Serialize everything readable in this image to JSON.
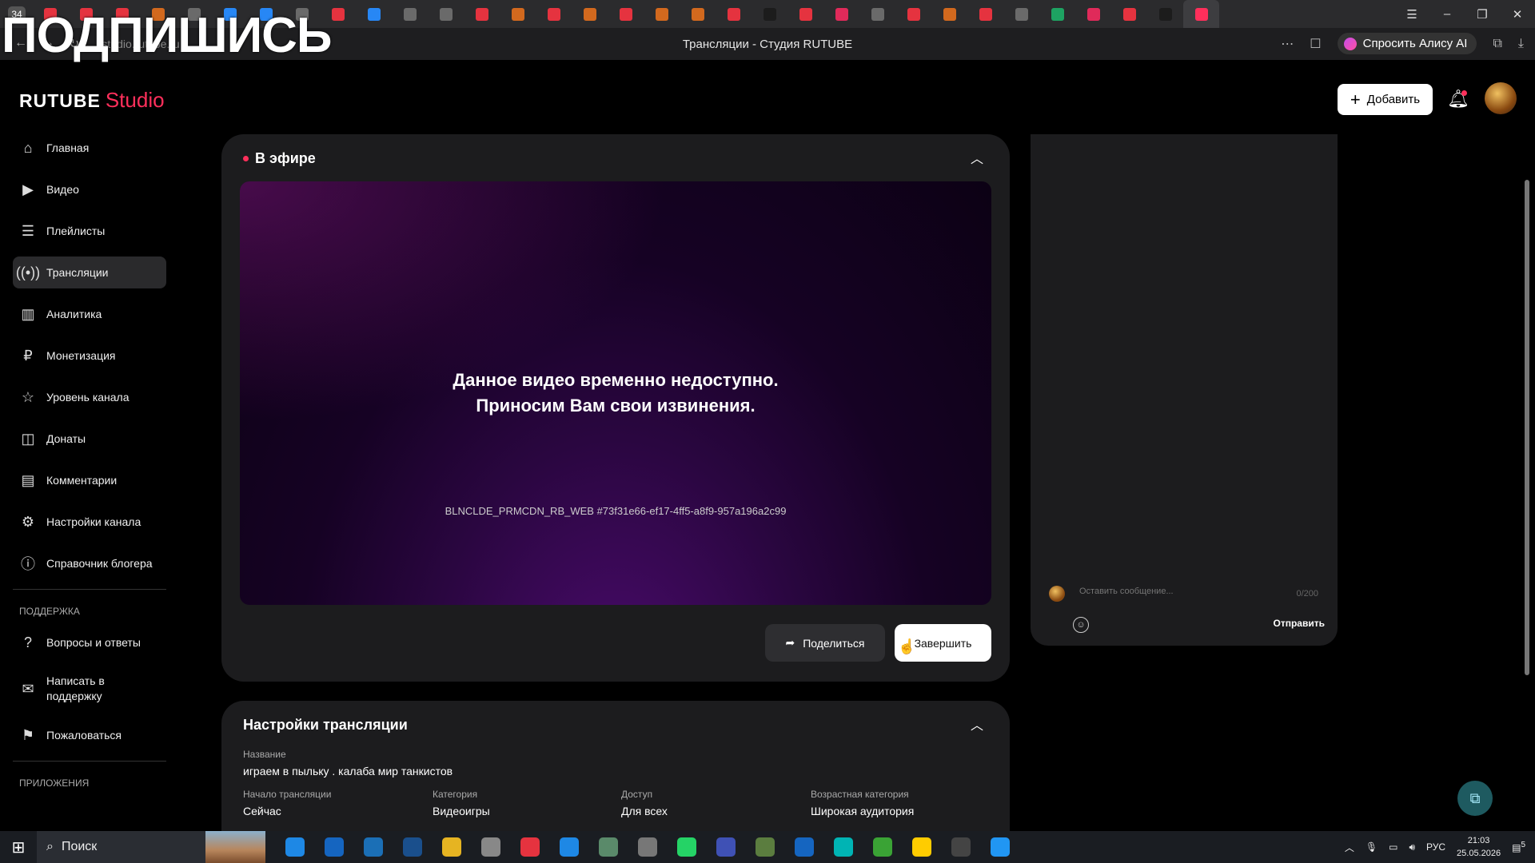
{
  "browser": {
    "tab_count": "34",
    "url": "studio.rutube.ru",
    "page_title": "Трансляции - Студия RUTUBE",
    "alice_label": "Спросить Алису AI",
    "tab_icon_colors": [
      "#e5333f",
      "#e5333f",
      "#e5333f",
      "#d2691e",
      "#6a6a6a",
      "#2787f5",
      "#2787f5",
      "#6a6a6a",
      "#e5333f",
      "#2787f5",
      "#6a6a6a",
      "#6a6a6a",
      "#e5333f",
      "#d2691e",
      "#e5333f",
      "#d2691e",
      "#e5333f",
      "#d2691e",
      "#d2691e",
      "#e5333f",
      "#1c1c1c",
      "#e5333f",
      "#e02a5a",
      "#6a6a6a",
      "#e5333f",
      "#d2691e",
      "#e5333f",
      "#6a6a6a",
      "#1ea362",
      "#e02a5a",
      "#e5333f",
      "#1c1c1c",
      "#ff2f5b"
    ]
  },
  "overlay_text": "ПОДПИШИСЬ",
  "header": {
    "logo_main": "RUTUBE",
    "logo_sub": "Studio",
    "add_label": "Добавить"
  },
  "sidebar": {
    "items": [
      {
        "label": "Главная",
        "icon": "home-icon"
      },
      {
        "label": "Видео",
        "icon": "video-icon"
      },
      {
        "label": "Плейлисты",
        "icon": "playlist-icon"
      },
      {
        "label": "Трансляции",
        "icon": "broadcast-icon"
      },
      {
        "label": "Аналитика",
        "icon": "analytics-icon"
      },
      {
        "label": "Монетизация",
        "icon": "ruble-icon"
      },
      {
        "label": "Уровень канала",
        "icon": "star-icon"
      },
      {
        "label": "Донаты",
        "icon": "donate-icon"
      },
      {
        "label": "Комментарии",
        "icon": "comment-icon"
      },
      {
        "label": "Настройки канала",
        "icon": "gear-icon"
      },
      {
        "label": "Справочник блогера",
        "icon": "info-icon"
      }
    ],
    "support_heading": "ПОДДЕРЖКА",
    "support_items": [
      {
        "label": "Вопросы и ответы",
        "icon": "question-icon"
      },
      {
        "label": "Написать в поддержку",
        "icon": "mail-icon"
      },
      {
        "label": "Пожаловаться",
        "icon": "flag-icon"
      }
    ],
    "apps_heading": "ПРИЛОЖЕНИЯ"
  },
  "live": {
    "title": "В эфире",
    "message_line1": "Данное видео временно недоступно.",
    "message_line2": "Приносим Вам свои извинения.",
    "error_code": "BLNCLDE_PRMCDN_RB_WEB #73f31e66-ef17-4ff5-a8f9-957a196a2c99",
    "share_label": "Поделиться",
    "finish_label": "Завершить"
  },
  "chat": {
    "placeholder": "Оставить сообщение...",
    "counter": "0/200",
    "send_label": "Отправить"
  },
  "settings": {
    "title": "Настройки трансляции",
    "name_label": "Название",
    "name_value": "играем в пыльку . калаба мир танкистов",
    "fields": [
      {
        "label": "Начало трансляции",
        "value": "Сейчас"
      },
      {
        "label": "Категория",
        "value": "Видеоигры"
      },
      {
        "label": "Доступ",
        "value": "Для всех"
      },
      {
        "label": "Возрастная категория",
        "value": "Широкая аудитория"
      }
    ]
  },
  "taskbar": {
    "search_label": "Поиск",
    "lang": "РУС",
    "time": "21:03",
    "date": "25.05.2026",
    "notifications": "5",
    "app_colors": [
      "#1e88e5",
      "#1565c0",
      "#1b6fb6",
      "#1a4f8c",
      "#e6b422",
      "#888888",
      "#e5333f",
      "#1e88e5",
      "#5a8a6a",
      "#777777",
      "#25d366",
      "#3f51b5",
      "#5b7d3f",
      "#1565c0",
      "#00b4b4",
      "#3aa335",
      "#ffcc00",
      "#444444",
      "#2196f3"
    ]
  }
}
